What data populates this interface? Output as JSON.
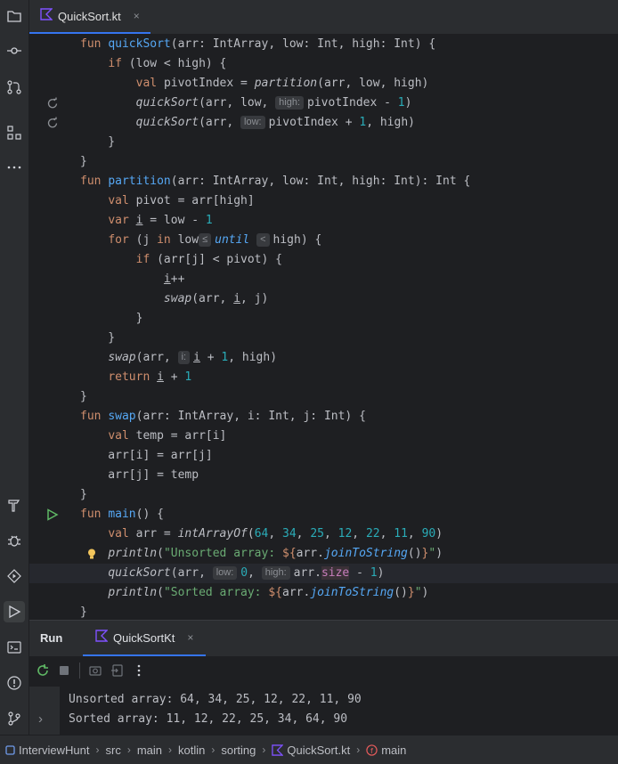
{
  "editor_tab": {
    "label": "QuickSort.kt",
    "close": "×"
  },
  "code_lines": [
    {
      "gutter": "",
      "cur": false,
      "segs": [
        [
          "kw",
          "fun "
        ],
        [
          "fn",
          "quickSort"
        ],
        [
          "",
          "(arr: IntArray, low: Int, high: Int) {"
        ]
      ]
    },
    {
      "gutter": "",
      "cur": false,
      "segs": [
        [
          "",
          "    "
        ],
        [
          "kw",
          "if "
        ],
        [
          "",
          "(low < high) {"
        ]
      ]
    },
    {
      "gutter": "",
      "cur": false,
      "segs": [
        [
          "",
          "        "
        ],
        [
          "kw",
          "val "
        ],
        [
          "",
          "pivotIndex = "
        ],
        [
          "it",
          "partition"
        ],
        [
          "",
          "(arr, low, high)"
        ]
      ]
    },
    {
      "gutter": "recursive-call-icon",
      "cur": false,
      "segs": [
        [
          "",
          "        "
        ],
        [
          "it",
          "quickSort"
        ],
        [
          "",
          "(arr, low, "
        ],
        [
          "hint",
          "high:"
        ],
        [
          "",
          "pivotIndex - "
        ],
        [
          "num",
          "1"
        ],
        [
          "",
          ")"
        ]
      ]
    },
    {
      "gutter": "recursive-call-icon",
      "cur": false,
      "segs": [
        [
          "",
          "        "
        ],
        [
          "it",
          "quickSort"
        ],
        [
          "",
          "(arr, "
        ],
        [
          "hint",
          "low:"
        ],
        [
          "",
          "pivotIndex + "
        ],
        [
          "num",
          "1"
        ],
        [
          "",
          ", high)"
        ]
      ]
    },
    {
      "gutter": "",
      "cur": false,
      "segs": [
        [
          "",
          "    }"
        ]
      ]
    },
    {
      "gutter": "",
      "cur": false,
      "segs": [
        [
          "",
          "}"
        ]
      ]
    },
    {
      "gutter": "",
      "cur": false,
      "segs": [
        [
          "kw",
          "fun "
        ],
        [
          "fn",
          "partition"
        ],
        [
          "",
          "(arr: IntArray, low: Int, high: Int): Int {"
        ]
      ]
    },
    {
      "gutter": "",
      "cur": false,
      "segs": [
        [
          "",
          "    "
        ],
        [
          "kw",
          "val "
        ],
        [
          "",
          "pivot = arr[high]"
        ]
      ]
    },
    {
      "gutter": "",
      "cur": false,
      "segs": [
        [
          "",
          "    "
        ],
        [
          "kw",
          "var "
        ],
        [
          "ul",
          "i"
        ],
        [
          "",
          " = low - "
        ],
        [
          "num",
          "1"
        ]
      ]
    },
    {
      "gutter": "",
      "cur": false,
      "segs": [
        [
          "",
          "    "
        ],
        [
          "kw",
          "for "
        ],
        [
          "",
          "(j "
        ],
        [
          "kw",
          "in "
        ],
        [
          "",
          "low"
        ],
        [
          "hint",
          "≤"
        ],
        [
          "fi",
          "until "
        ],
        [
          "hint",
          "<"
        ],
        [
          "",
          "high) {"
        ]
      ]
    },
    {
      "gutter": "",
      "cur": false,
      "segs": [
        [
          "",
          "        "
        ],
        [
          "kw",
          "if "
        ],
        [
          "",
          "(arr[j] < pivot) {"
        ]
      ]
    },
    {
      "gutter": "",
      "cur": false,
      "segs": [
        [
          "",
          "            "
        ],
        [
          "ul",
          "i"
        ],
        [
          "",
          "++"
        ]
      ]
    },
    {
      "gutter": "",
      "cur": false,
      "segs": [
        [
          "",
          "            "
        ],
        [
          "it",
          "swap"
        ],
        [
          "",
          "(arr, "
        ],
        [
          "ul",
          "i"
        ],
        [
          "",
          ", j)"
        ]
      ]
    },
    {
      "gutter": "",
      "cur": false,
      "segs": [
        [
          "",
          "        }"
        ]
      ]
    },
    {
      "gutter": "",
      "cur": false,
      "segs": [
        [
          "",
          "    }"
        ]
      ]
    },
    {
      "gutter": "",
      "cur": false,
      "segs": [
        [
          "",
          "    "
        ],
        [
          "it",
          "swap"
        ],
        [
          "",
          "(arr, "
        ],
        [
          "hint",
          "i:"
        ],
        [
          "ul",
          "i"
        ],
        [
          "",
          " + "
        ],
        [
          "num",
          "1"
        ],
        [
          "",
          ", high)"
        ]
      ]
    },
    {
      "gutter": "",
      "cur": false,
      "segs": [
        [
          "",
          "    "
        ],
        [
          "kw",
          "return "
        ],
        [
          "ul",
          "i"
        ],
        [
          "",
          " + "
        ],
        [
          "num",
          "1"
        ]
      ]
    },
    {
      "gutter": "",
      "cur": false,
      "segs": [
        [
          "",
          "}"
        ]
      ]
    },
    {
      "gutter": "",
      "cur": false,
      "segs": [
        [
          "kw",
          "fun "
        ],
        [
          "fn",
          "swap"
        ],
        [
          "",
          "(arr: IntArray, i: Int, j: Int) {"
        ]
      ]
    },
    {
      "gutter": "",
      "cur": false,
      "segs": [
        [
          "",
          "    "
        ],
        [
          "kw",
          "val "
        ],
        [
          "",
          "temp = arr[i]"
        ]
      ]
    },
    {
      "gutter": "",
      "cur": false,
      "segs": [
        [
          "",
          "    arr[i] = arr[j]"
        ]
      ]
    },
    {
      "gutter": "",
      "cur": false,
      "segs": [
        [
          "",
          "    arr[j] = temp"
        ]
      ]
    },
    {
      "gutter": "",
      "cur": false,
      "segs": [
        [
          "",
          "}"
        ]
      ]
    },
    {
      "gutter": "run-icon",
      "cur": false,
      "segs": [
        [
          "kw",
          "fun "
        ],
        [
          "fn",
          "main"
        ],
        [
          "",
          "() {"
        ]
      ]
    },
    {
      "gutter": "",
      "cur": false,
      "segs": [
        [
          "",
          "    "
        ],
        [
          "kw",
          "val "
        ],
        [
          "",
          "arr = "
        ],
        [
          "it",
          "intArrayOf"
        ],
        [
          "",
          "("
        ],
        [
          "num",
          "64"
        ],
        [
          "",
          ", "
        ],
        [
          "num",
          "34"
        ],
        [
          "",
          ", "
        ],
        [
          "num",
          "25"
        ],
        [
          "",
          ", "
        ],
        [
          "num",
          "12"
        ],
        [
          "",
          ", "
        ],
        [
          "num",
          "22"
        ],
        [
          "",
          ", "
        ],
        [
          "num",
          "11"
        ],
        [
          "",
          ", "
        ],
        [
          "num",
          "90"
        ],
        [
          "",
          ")"
        ]
      ]
    },
    {
      "gutter": "",
      "cur": false,
      "segs": [
        [
          "",
          "    "
        ],
        [
          "it",
          "println"
        ],
        [
          "",
          "("
        ],
        [
          "str",
          "\"Unsorted array: "
        ],
        [
          "kw",
          "${"
        ],
        [
          "",
          "arr."
        ],
        [
          "fi",
          "joinToString"
        ],
        [
          "",
          "()"
        ],
        [
          "kw",
          "}"
        ],
        [
          "str",
          "\""
        ],
        [
          "",
          ")"
        ]
      ]
    },
    {
      "gutter": "",
      "cur": true,
      "segs": [
        [
          "",
          "    "
        ],
        [
          "it",
          "quickSort"
        ],
        [
          "",
          "(arr, "
        ],
        [
          "hint",
          "low:"
        ],
        [
          "num",
          "0"
        ],
        [
          "",
          ", "
        ],
        [
          "hint",
          "high:"
        ],
        [
          "",
          "arr."
        ],
        [
          "prop",
          "size"
        ],
        [
          "",
          " - "
        ],
        [
          "num",
          "1"
        ],
        [
          "",
          ")"
        ]
      ]
    },
    {
      "gutter": "",
      "cur": false,
      "segs": [
        [
          "",
          "    "
        ],
        [
          "it",
          "println"
        ],
        [
          "",
          "("
        ],
        [
          "str",
          "\"Sorted array: "
        ],
        [
          "kw",
          "${"
        ],
        [
          "",
          "arr."
        ],
        [
          "fi",
          "joinToString"
        ],
        [
          "",
          "()"
        ],
        [
          "kw",
          "}"
        ],
        [
          "str",
          "\""
        ],
        [
          "",
          ")"
        ]
      ]
    },
    {
      "gutter": "",
      "cur": false,
      "segs": [
        [
          "",
          "}"
        ]
      ]
    }
  ],
  "run_panel": {
    "label": "Run",
    "tab_label": "QuickSortKt",
    "tab_close": "×",
    "output": [
      "Unsorted array: 64, 34, 25, 12, 22, 11, 90",
      "Sorted array: 11, 12, 22, 25, 34, 64, 90"
    ],
    "expand_glyph": "›"
  },
  "breadcrumbs": [
    "InterviewHunt",
    "src",
    "main",
    "kotlin",
    "sorting",
    "QuickSort.kt",
    "main"
  ],
  "breadcrumb_separator": "›",
  "colors": {
    "accent": "#3574f0",
    "keyword": "#cf8e6d",
    "function": "#56a8f5",
    "number": "#2aacb8",
    "string": "#6aab73",
    "kotlin": "#7f52ff",
    "run": "#5fb865"
  }
}
